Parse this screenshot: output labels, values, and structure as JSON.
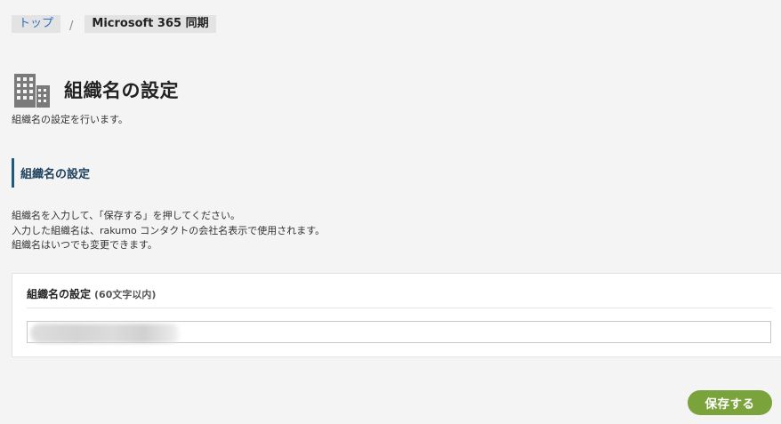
{
  "breadcrumb": {
    "home_label": "トップ",
    "separator": "/",
    "current_label": "Microsoft 365 同期"
  },
  "page": {
    "icon": "building-icon",
    "title": "組織名の設定",
    "description": "組織名の設定を行います。"
  },
  "section": {
    "title": "組織名の設定",
    "instructions": [
      "組織名を入力して、「保存する」を押してください。",
      "入力した組織名は、rakumo コンタクトの会社名表示で使用されます。",
      "組織名はいつでも変更できます。"
    ]
  },
  "form": {
    "label": "組織名の設定",
    "hint": "(60文字以内)",
    "input_value": ""
  },
  "actions": {
    "save_label": "保存する"
  },
  "colors": {
    "accent_green": "#7aa33c",
    "section_border": "#1c5a7e",
    "link_blue": "#2a6fb5",
    "background": "#f4f4f4"
  }
}
